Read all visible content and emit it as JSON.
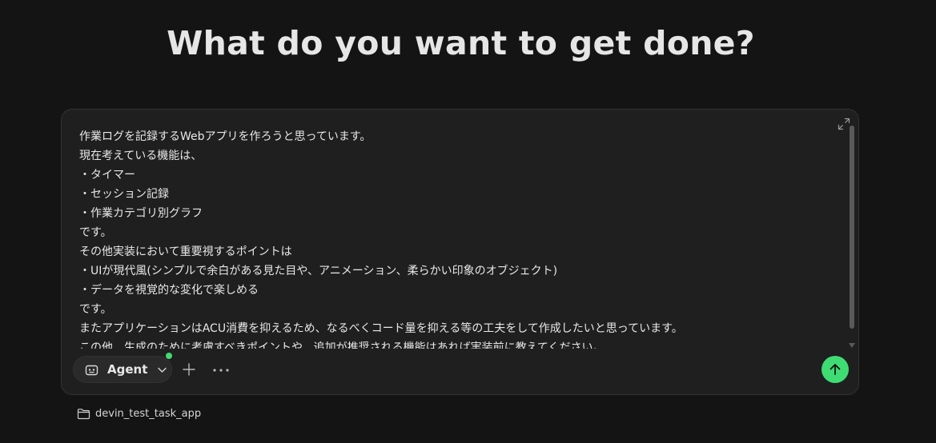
{
  "heading": "What do you want to get done?",
  "composer": {
    "prompt_text": "作業ログを記録するWebアプリを作ろうと思っています。\n現在考えている機能は、\n・タイマー\n・セッション記録\n・作業カテゴリ別グラフ\nです。\nその他実装において重要視するポイントは\n・UIが現代風(シンプルで余白がある見た目や、アニメーション、柔らかい印象のオブジェクト)\n・データを視覚的な変化で楽しめる\nです。\nまたアプリケーションはACU消費を抑えるため、なるべくコード量を抑える等の工夫をして作成したいと思っています。\nこの他、生成のために考慮すべきポイントや、追加が推奨される機能はあれば実装前に教えてください。",
    "mode_label": "Agent",
    "status_color": "#43d873",
    "send_color": "#3fdc74"
  },
  "icons": {
    "expand": "expand-icon",
    "bot": "bot-icon",
    "chevron": "chevron-down-icon",
    "plus": "plus-icon",
    "more": "more-horizontal-icon",
    "send": "arrow-up-icon",
    "folder": "folder-icon"
  },
  "repo": {
    "name": "devin_test_task_app"
  }
}
